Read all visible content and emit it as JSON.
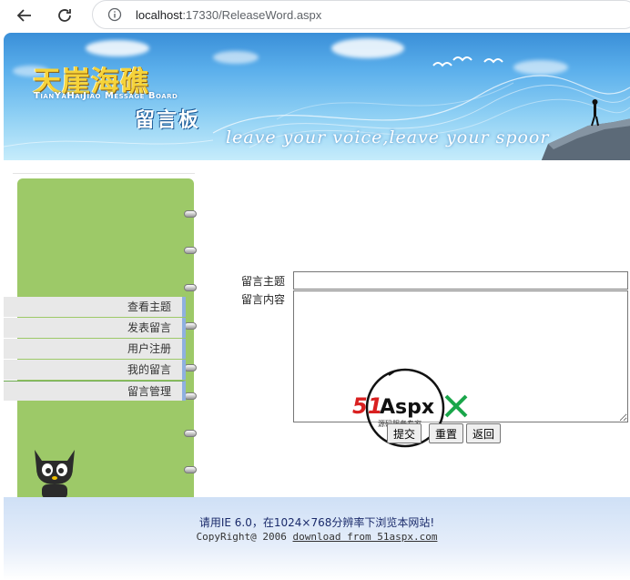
{
  "browser": {
    "url_host": "localhost",
    "url_rest": ":17330/ReleaseWord.aspx"
  },
  "banner": {
    "title": "天崖海礁",
    "subtitle": "TianYaHaiJiao Message Board",
    "board": "留言板",
    "slogan": "leave your voice,leave your spoor"
  },
  "sidebar": {
    "items": [
      {
        "label": "查看主题"
      },
      {
        "label": "发表留言"
      },
      {
        "label": "用户注册"
      },
      {
        "label": "我的留言"
      },
      {
        "label": "留言管理"
      }
    ]
  },
  "form": {
    "subject_label": "留言主题",
    "content_label": "留言内容",
    "subject_value": "",
    "content_value": "",
    "submit_label": "提交",
    "reset_label": "重置",
    "back_label": "返回"
  },
  "watermark": {
    "brand_red": "51",
    "brand_rest": "Aspx",
    "tagline": "源码服务专家"
  },
  "footer": {
    "line1": "请用IE 6.0，在1024×768分辨率下浏览本网站!",
    "copyright": "CopyRight@ 2006",
    "link_text": "download from 51aspx.com"
  },
  "colors": {
    "sidebar_green": "#9dc968",
    "banner_blue": "#5cb0ec",
    "footer_text": "#1a2a6a"
  }
}
